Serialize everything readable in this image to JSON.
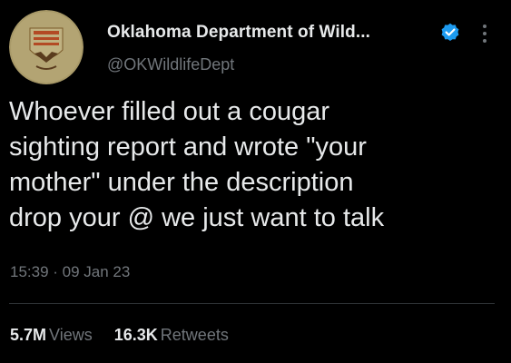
{
  "tweet": {
    "author": {
      "display_name": "Oklahoma Department of Wild...",
      "handle": "@OKWildlifeDept",
      "verified": true,
      "avatar_icon": "agency-logo-icon",
      "avatar_colors": {
        "background": "#a89968",
        "emblem": "#b34a24",
        "text": "#5a3c1e"
      }
    },
    "text": "Whoever filled out a cougar\nsighting report and wrote \"your\nmother\" under the description\ndrop your @ we just want to talk",
    "timestamp": "15:39 · 09 Jan 23",
    "stats": {
      "views_count": "5.7M",
      "views_label": "Views",
      "retweets_count": "16.3K",
      "retweets_label": "Retweets"
    }
  },
  "colors": {
    "background": "#000000",
    "primary_text": "#e7e9ea",
    "secondary_text": "#71767b",
    "verified_badge": "#1d9bf0",
    "divider": "#2f3336"
  }
}
